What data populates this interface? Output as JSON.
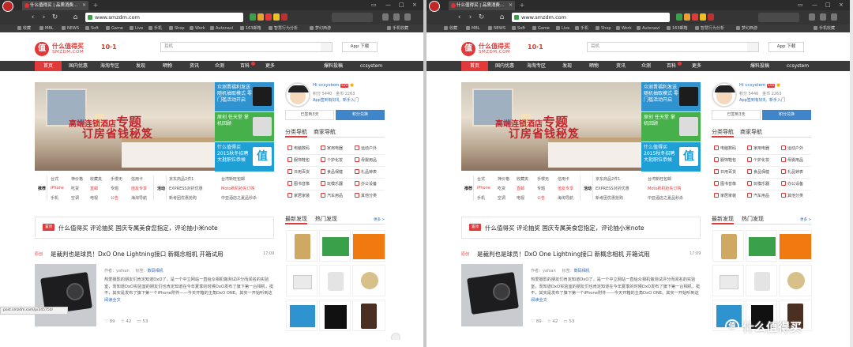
{
  "browser": {
    "tab_title": "什么值得买 | 品质消费...",
    "tab_close": "×",
    "new_tab": "+",
    "url": "www.smzdm.com",
    "back": "‹",
    "forward": "›",
    "reload": "↻",
    "home": "⌂",
    "window_controls": [
      "▭",
      "—",
      "□",
      "×"
    ],
    "bookmarks": [
      "收藏",
      "MBL",
      "NEWS",
      "Soft",
      "Game",
      "Live",
      "手机",
      "Shop",
      "Work",
      "Autonavi",
      "163邮箱",
      "智慧行为分析",
      "梦幻西游",
      "手机收藏"
    ],
    "status_url": "post.smzdm.com/p/345750/"
  },
  "site": {
    "logo_glyph": "值",
    "logo_name": "什么值得买",
    "logo_domain": "SMZDM.COM",
    "logo_deco": "10·1",
    "search_placeholder": "耳机",
    "app_download": "App 下载",
    "nav": [
      {
        "label": "首页",
        "active": true
      },
      {
        "label": "国内优惠"
      },
      {
        "label": "海淘专区"
      },
      {
        "label": "发现"
      },
      {
        "label": "晒物"
      },
      {
        "label": "资讯"
      },
      {
        "label": "众测"
      },
      {
        "label": "百科"
      },
      {
        "label": "更多"
      },
      {
        "label": "爆料投稿"
      },
      {
        "label": "ccsystem"
      }
    ]
  },
  "banner": {
    "title_small": "高端连锁酒店",
    "title_big": "专题",
    "subtitle": "订房省钱秘笈"
  },
  "promos": [
    {
      "text": "众测晋福利发送 随机抽取模式 零门槛活动开启",
      "color": "#2f93d0"
    },
    {
      "text": "原创 任天堂 掌机回顾",
      "color": "#46b04a"
    },
    {
      "text": "什么值得买 2015秋冬招聘 大批职位恭候",
      "color": "#1e9fd6"
    }
  ],
  "catlinks": {
    "label1": "推荐",
    "col1": [
      [
        "台式",
        "神价格",
        "收藏夹",
        "手慢无",
        "信用卡"
      ],
      [
        "iPhone",
        "吃货",
        "直邮",
        "专题",
        "值友专享"
      ],
      [
        "手机",
        "空调",
        "电视",
        "公告",
        "海淘导航"
      ]
    ],
    "label2": "活动",
    "col2": [
      "京东商品2件1",
      "EXPRESS对折优惠",
      "新考团优惠抢购"
    ],
    "col3": [
      "台湾新旺包邮",
      "Moto新机抢先订购",
      "中亚酒店之夏品秒杀"
    ]
  },
  "headline": {
    "tag": "置顶",
    "text": "什么值得买 评论抽奖 国庆专属美食您指定，评论抽小米note"
  },
  "article": {
    "tag": "原创",
    "title": "是裁判也是球员！DxO One Lightning接口 新概念相机 开箱试用",
    "date": "17:09",
    "author": "作者：yafsan",
    "category_label": "标签：",
    "category": "数码相机",
    "body": "热爱摄影的朋友们肯定知道DxO了，是一个中立网站一直给众相机做测试评分而闻名的实验室，而知道DxO实验室的朋友们也肯定知道在今年夏季的时候DxO发布了旗下第一台相机，挺不，其实是发布了旗下第一个iPhone附件——今天开箱的主角DxO ONE。其实一开始听到这",
    "read_more": "阅读全文",
    "likes": "89",
    "favs": "42",
    "comments": "53"
  },
  "user": {
    "name": "Hi ccsystem",
    "level": "Lv1",
    "points": "积分 5440",
    "gold": "金币 2263",
    "link_app": "App签到有好礼",
    "link_new": "新手入门",
    "checkin": "已签到3天",
    "exchange": "积分兑换"
  },
  "sidebar": {
    "tabs": [
      "分类导航",
      "商家导航"
    ],
    "categories": [
      [
        "电脑数码",
        "家用电器",
        "运动户外"
      ],
      [
        "服饰鞋包",
        "个护化妆",
        "母婴用品"
      ],
      [
        "日用百货",
        "食品保健",
        "礼品钟表"
      ],
      [
        "图书音像",
        "玩模乐器",
        "办公设备"
      ],
      [
        "家居家装",
        "汽车用品",
        "其他分类"
      ]
    ],
    "tabs2": [
      "最新发现",
      "热门发现"
    ],
    "more": "更多 >",
    "bottom_label": "专题"
  },
  "overlay": {
    "watermark_logo": "值",
    "watermark_text": "什么值得买"
  },
  "colors": {
    "brand_red": "#e23a3a",
    "nav_bg": "#3a3a3a",
    "link_blue": "#2d6ab7",
    "exchange_blue": "#3f85c9"
  }
}
